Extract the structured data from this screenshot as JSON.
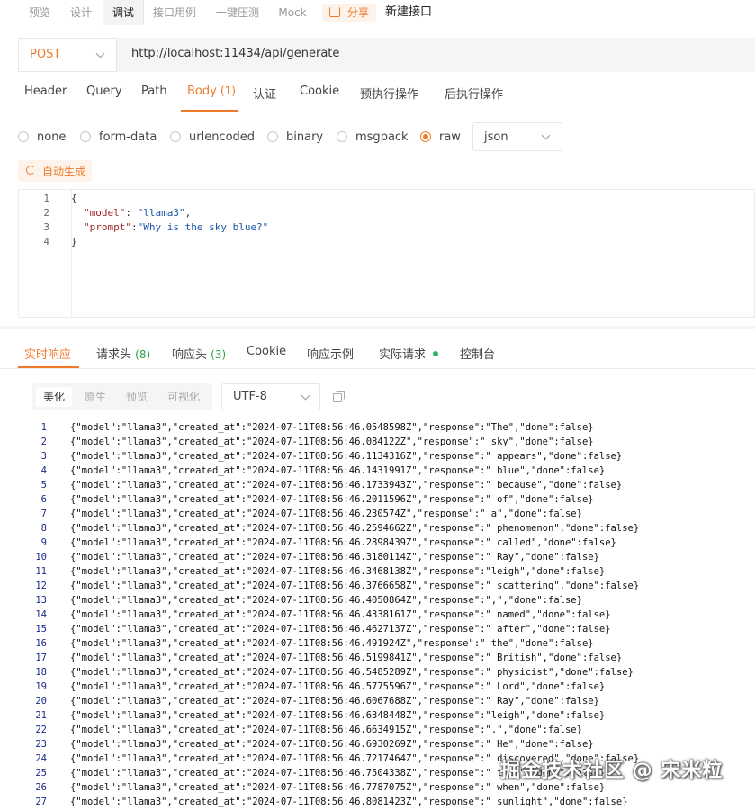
{
  "top_tabs": [
    "预览",
    "设计",
    "调试",
    "接口用例",
    "一键压测",
    "Mock"
  ],
  "share_label": "分享",
  "new_api_label": "新建接口",
  "request": {
    "method": "POST",
    "url": "http://localhost:11434/api/generate"
  },
  "request_tabs": {
    "header": "Header",
    "query": "Query",
    "path": "Path",
    "body": "Body",
    "body_count": "(1)",
    "auth": "认证",
    "cookie": "Cookie",
    "pre": "预执行操作",
    "post": "后执行操作"
  },
  "body_types": {
    "none": "none",
    "form_data": "form-data",
    "urlencoded": "urlencoded",
    "binary": "binary",
    "msgpack": "msgpack",
    "raw": "raw",
    "selected": "raw"
  },
  "raw_format": "json",
  "auto_generate_label": "自动生成",
  "body_code": {
    "line_numbers": [
      "1",
      "2",
      "3",
      "4"
    ],
    "open": "{",
    "model_key": "\"model\"",
    "model_sep": ": ",
    "model_val": "\"llama3\"",
    "model_end": ",",
    "prompt_key": "\"prompt\"",
    "prompt_sep": ":",
    "prompt_val": "\"Why is the sky blue?\"",
    "close": "}"
  },
  "response_tabs": {
    "realtime": "实时响应",
    "req_headers": "请求头",
    "req_headers_count": "(8)",
    "res_headers": "响应头",
    "res_headers_count": "(3)",
    "cookie": "Cookie",
    "example": "响应示例",
    "actual": "实际请求",
    "console": "控制台"
  },
  "view_modes": [
    "美化",
    "原生",
    "预览",
    "可视化"
  ],
  "encoding": "UTF-8",
  "response_lines": [
    {
      "n": "1",
      "c": "{\"model\":\"llama3\",\"created_at\":\"2024-07-11T08:56:46.0548598Z\",\"response\":\"The\",\"done\":false}"
    },
    {
      "n": "2",
      "c": "{\"model\":\"llama3\",\"created_at\":\"2024-07-11T08:56:46.084122Z\",\"response\":\" sky\",\"done\":false}"
    },
    {
      "n": "3",
      "c": "{\"model\":\"llama3\",\"created_at\":\"2024-07-11T08:56:46.1134316Z\",\"response\":\" appears\",\"done\":false}"
    },
    {
      "n": "4",
      "c": "{\"model\":\"llama3\",\"created_at\":\"2024-07-11T08:56:46.1431991Z\",\"response\":\" blue\",\"done\":false}"
    },
    {
      "n": "5",
      "c": "{\"model\":\"llama3\",\"created_at\":\"2024-07-11T08:56:46.1733943Z\",\"response\":\" because\",\"done\":false}"
    },
    {
      "n": "6",
      "c": "{\"model\":\"llama3\",\"created_at\":\"2024-07-11T08:56:46.2011596Z\",\"response\":\" of\",\"done\":false}"
    },
    {
      "n": "7",
      "c": "{\"model\":\"llama3\",\"created_at\":\"2024-07-11T08:56:46.230574Z\",\"response\":\" a\",\"done\":false}"
    },
    {
      "n": "8",
      "c": "{\"model\":\"llama3\",\"created_at\":\"2024-07-11T08:56:46.2594662Z\",\"response\":\" phenomenon\",\"done\":false}"
    },
    {
      "n": "9",
      "c": "{\"model\":\"llama3\",\"created_at\":\"2024-07-11T08:56:46.2898439Z\",\"response\":\" called\",\"done\":false}"
    },
    {
      "n": "10",
      "c": "{\"model\":\"llama3\",\"created_at\":\"2024-07-11T08:56:46.3180114Z\",\"response\":\" Ray\",\"done\":false}"
    },
    {
      "n": "11",
      "c": "{\"model\":\"llama3\",\"created_at\":\"2024-07-11T08:56:46.3468138Z\",\"response\":\"leigh\",\"done\":false}"
    },
    {
      "n": "12",
      "c": "{\"model\":\"llama3\",\"created_at\":\"2024-07-11T08:56:46.3766658Z\",\"response\":\" scattering\",\"done\":false}"
    },
    {
      "n": "13",
      "c": "{\"model\":\"llama3\",\"created_at\":\"2024-07-11T08:56:46.4050864Z\",\"response\":\",\",\"done\":false}"
    },
    {
      "n": "14",
      "c": "{\"model\":\"llama3\",\"created_at\":\"2024-07-11T08:56:46.4338161Z\",\"response\":\" named\",\"done\":false}"
    },
    {
      "n": "15",
      "c": "{\"model\":\"llama3\",\"created_at\":\"2024-07-11T08:56:46.4627137Z\",\"response\":\" after\",\"done\":false}"
    },
    {
      "n": "16",
      "c": "{\"model\":\"llama3\",\"created_at\":\"2024-07-11T08:56:46.491924Z\",\"response\":\" the\",\"done\":false}"
    },
    {
      "n": "17",
      "c": "{\"model\":\"llama3\",\"created_at\":\"2024-07-11T08:56:46.5199841Z\",\"response\":\" British\",\"done\":false}"
    },
    {
      "n": "18",
      "c": "{\"model\":\"llama3\",\"created_at\":\"2024-07-11T08:56:46.5485289Z\",\"response\":\" physicist\",\"done\":false}"
    },
    {
      "n": "19",
      "c": "{\"model\":\"llama3\",\"created_at\":\"2024-07-11T08:56:46.5775596Z\",\"response\":\" Lord\",\"done\":false}"
    },
    {
      "n": "20",
      "c": "{\"model\":\"llama3\",\"created_at\":\"2024-07-11T08:56:46.6067688Z\",\"response\":\" Ray\",\"done\":false}"
    },
    {
      "n": "21",
      "c": "{\"model\":\"llama3\",\"created_at\":\"2024-07-11T08:56:46.6348448Z\",\"response\":\"leigh\",\"done\":false}"
    },
    {
      "n": "22",
      "c": "{\"model\":\"llama3\",\"created_at\":\"2024-07-11T08:56:46.6634915Z\",\"response\":\".\",\"done\":false}"
    },
    {
      "n": "23",
      "c": "{\"model\":\"llama3\",\"created_at\":\"2024-07-11T08:56:46.6930269Z\",\"response\":\" He\",\"done\":false}"
    },
    {
      "n": "24",
      "c": "{\"model\":\"llama3\",\"created_at\":\"2024-07-11T08:56:46.7217464Z\",\"response\":\" discovered\",\"done\":false}"
    },
    {
      "n": "25",
      "c": "{\"model\":\"llama3\",\"created_at\":\"2024-07-11T08:56:46.7504338Z\",\"response\":\" that\",\"done\":false}"
    },
    {
      "n": "26",
      "c": "{\"model\":\"llama3\",\"created_at\":\"2024-07-11T08:56:46.7787075Z\",\"response\":\" when\",\"done\":false}"
    },
    {
      "n": "27",
      "c": "{\"model\":\"llama3\",\"created_at\":\"2024-07-11T08:56:46.8081423Z\",\"response\":\" sunlight\",\"done\":false}"
    }
  ],
  "watermark": "掘金技术社区 @ 宋米粒",
  "colors": {
    "accent": "#ef7b2a",
    "green": "#27a344"
  }
}
